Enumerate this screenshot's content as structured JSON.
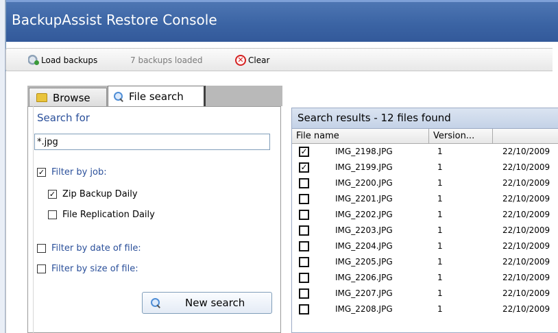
{
  "window": {
    "title": "BackupAssist Restore Console"
  },
  "toolbar": {
    "load_label": "Load backups",
    "status": "7 backups loaded",
    "clear_label": "Clear"
  },
  "tabs": [
    {
      "label": "Browse",
      "icon": "folder-icon",
      "active": false
    },
    {
      "label": "File search",
      "icon": "search-icon",
      "active": true
    }
  ],
  "search": {
    "heading": "Search for",
    "value": "*.jpg",
    "filter_job": {
      "label": "Filter by job:",
      "checked": true
    },
    "jobs": [
      {
        "label": "Zip Backup Daily",
        "checked": true
      },
      {
        "label": "File Replication Daily",
        "checked": false
      }
    ],
    "filter_date": {
      "label": "Filter by date of file:",
      "checked": false
    },
    "filter_size": {
      "label": "Filter by size of file:",
      "checked": false
    },
    "button": "New search"
  },
  "results": {
    "header": "Search results - 12 files found",
    "columns": [
      "File name",
      "Version...",
      ""
    ],
    "rows": [
      {
        "checked": true,
        "name": "IMG_2198.JPG",
        "version": "1",
        "date": "22/10/2009"
      },
      {
        "checked": true,
        "name": "IMG_2199.JPG",
        "version": "1",
        "date": "22/10/2009"
      },
      {
        "checked": false,
        "name": "IMG_2200.JPG",
        "version": "1",
        "date": "22/10/2009"
      },
      {
        "checked": false,
        "name": "IMG_2201.JPG",
        "version": "1",
        "date": "22/10/2009"
      },
      {
        "checked": false,
        "name": "IMG_2202.JPG",
        "version": "1",
        "date": "22/10/2009"
      },
      {
        "checked": false,
        "name": "IMG_2203.JPG",
        "version": "1",
        "date": "22/10/2009"
      },
      {
        "checked": false,
        "name": "IMG_2204.JPG",
        "version": "1",
        "date": "22/10/2009"
      },
      {
        "checked": false,
        "name": "IMG_2205.JPG",
        "version": "1",
        "date": "22/10/2009"
      },
      {
        "checked": false,
        "name": "IMG_2206.JPG",
        "version": "1",
        "date": "22/10/2009"
      },
      {
        "checked": false,
        "name": "IMG_2207.JPG",
        "version": "1",
        "date": "22/10/2009"
      },
      {
        "checked": false,
        "name": "IMG_2208.JPG",
        "version": "1",
        "date": "22/10/2009"
      }
    ]
  },
  "colors": {
    "titlebar": "#3b64a4",
    "link_blue": "#2a4f9a",
    "clear_red": "#d42020"
  }
}
